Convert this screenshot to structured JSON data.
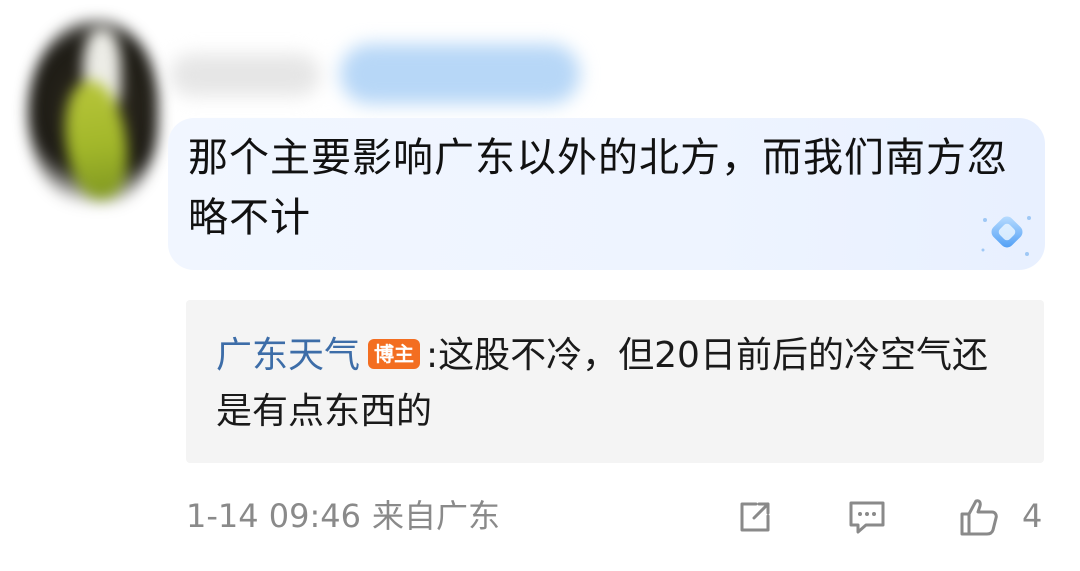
{
  "comment": {
    "text": "那个主要影响广东以外的北方，而我们南方忽略不计"
  },
  "reply": {
    "author": "广东天气",
    "badge": "博主",
    "separator": ":",
    "text": "这股不冷，但20日前后的冷空气还是有点东西的"
  },
  "footer": {
    "time": "1-14 09:46",
    "location": "来自广东",
    "like_count": "4"
  },
  "icons": {
    "share": "share-icon",
    "comment": "comment-icon",
    "like": "thumbs-up-icon",
    "badge": "diamond-badge-icon"
  },
  "colors": {
    "author": "#3d6da8",
    "badge_bg": "#f36e21",
    "meta": "#8a8a8a",
    "bubble_bg": "#eef4ff"
  }
}
